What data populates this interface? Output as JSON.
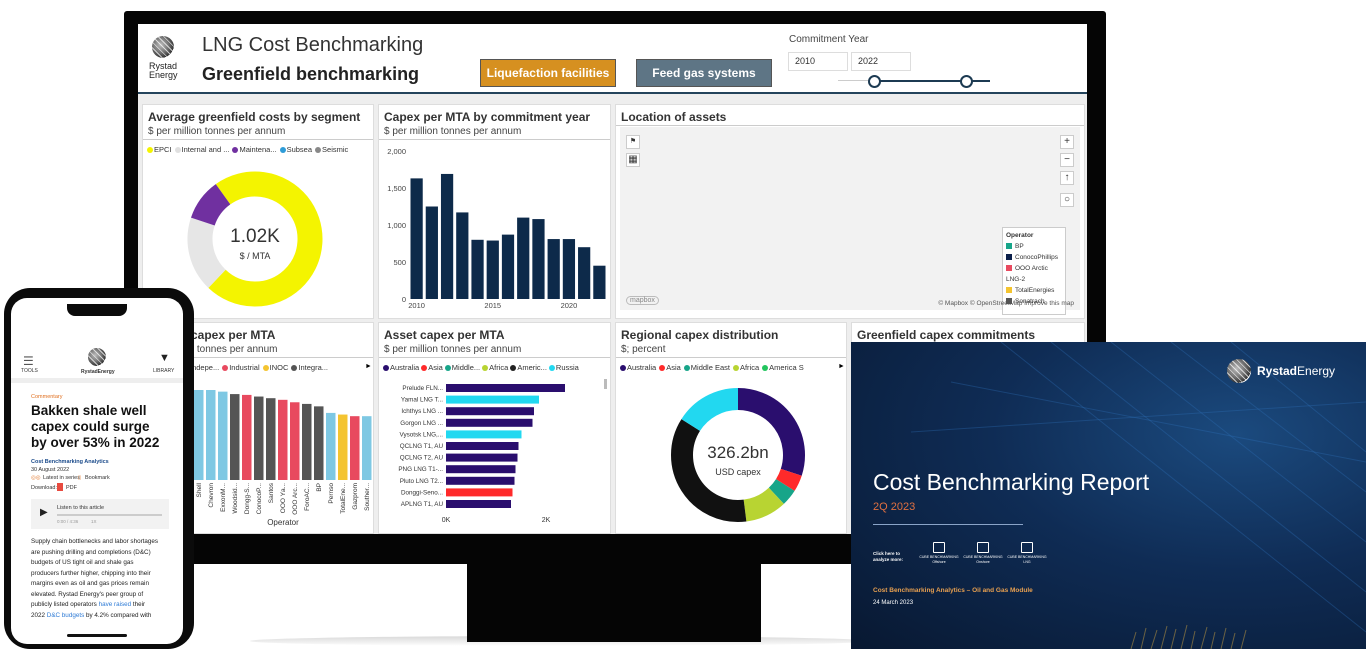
{
  "dashboard": {
    "logo_brand": "Rystad",
    "logo_sub": "Energy",
    "title": "LNG Cost Benchmarking",
    "subtitle": "Greenfield benchmarking",
    "buttons": {
      "liquefaction": "Liquefaction facilities",
      "feed_gas": "Feed gas systems"
    },
    "commitment_year": {
      "label": "Commitment Year",
      "from": "2010",
      "to": "2022"
    }
  },
  "panels": {
    "avg_costs": {
      "title": "Average greenfield costs by segment",
      "subtitle": "$ per million tonnes per annum",
      "legend": [
        {
          "label": "EPCI",
          "color": "#f4f400"
        },
        {
          "label": "Internal and ...",
          "color": "#e0e0e0"
        },
        {
          "label": "Maintena...",
          "color": "#7030a0"
        },
        {
          "label": "Subsea",
          "color": "#2e9cd8"
        },
        {
          "label": "Seismic",
          "color": "#888888"
        }
      ],
      "center_value": "1.02K",
      "center_unit": "$ / MTA"
    },
    "capex_year": {
      "title": "Capex per MTA by commitment year",
      "subtitle": "$ per million tonnes per annum"
    },
    "location": {
      "title": "Location of assets",
      "legend_title": "Operator",
      "legend_items": [
        {
          "label": "BP",
          "color": "#17a589"
        },
        {
          "label": "ConocoPhillips",
          "color": "#0b1f4a"
        },
        {
          "label": "OOO Arctic",
          "color": "#e84a5f"
        },
        {
          "label": "LNG-2",
          "color": ""
        },
        {
          "label": "TotalEnergies",
          "color": "#f4c430"
        },
        {
          "label": "Sonatrach",
          "color": "#555555"
        }
      ],
      "attribution": "© Mapbox © OpenStreetMap Improve this map",
      "mapbox_logo": "mapbox"
    },
    "operator_capex": {
      "title": "r capex per MTA",
      "subtitle": "on tonnes per annum",
      "legend": [
        {
          "label": "Indepe...",
          "color": "#7ec8e3"
        },
        {
          "label": "Industrial",
          "color": "#e84a5f"
        },
        {
          "label": "INOC",
          "color": "#f4c430"
        },
        {
          "label": "Integra...",
          "color": "#555555"
        }
      ],
      "xlabel": "Operator"
    },
    "asset_capex": {
      "title": "Asset capex per MTA",
      "subtitle": "$ per million tonnes per annum",
      "legend": [
        {
          "label": "Australia",
          "color": "#2a0e6e"
        },
        {
          "label": "Asia",
          "color": "#ff2a2a"
        },
        {
          "label": "Middle...",
          "color": "#17a589"
        },
        {
          "label": "Africa",
          "color": "#b8d432"
        },
        {
          "label": "Americ...",
          "color": "#222222"
        },
        {
          "label": "Russia",
          "color": "#22d8f0"
        }
      ]
    },
    "regional": {
      "title": "Regional capex distribution",
      "subtitle": "$; percent",
      "legend": [
        {
          "label": "Australia",
          "color": "#2a0e6e"
        },
        {
          "label": "Asia",
          "color": "#ff2a2a"
        },
        {
          "label": "Middle East",
          "color": "#17a589"
        },
        {
          "label": "Africa",
          "color": "#b8d432"
        },
        {
          "label": "America S",
          "color": "#22c55e"
        }
      ],
      "center_value": "326.2bn",
      "center_unit": "USD capex"
    },
    "commitments": {
      "title": "Greenfield capex commitments"
    }
  },
  "chart_data": [
    {
      "type": "pie",
      "title": "Average greenfield costs by segment",
      "categories": [
        "EPCI",
        "Internal and ...",
        "Maintena..."
      ],
      "values": [
        72,
        18,
        10
      ],
      "colors": [
        "#f4f400",
        "#e6e6e6",
        "#7030a0"
      ]
    },
    {
      "type": "bar",
      "title": "Capex per MTA by commitment year",
      "x": [
        2010,
        2011,
        2012,
        2013,
        2014,
        2015,
        2016,
        2017,
        2018,
        2019,
        2020,
        2021,
        2022
      ],
      "values": [
        1630,
        1250,
        1690,
        1170,
        800,
        790,
        870,
        1100,
        1080,
        810,
        810,
        700,
        450
      ],
      "ylim": [
        0,
        2000
      ],
      "yticks": [
        "0",
        "500",
        "1,000",
        "1,500",
        "2,000"
      ],
      "xticks": [
        "2010",
        "2015",
        "2020"
      ],
      "color": "#0d2a4a"
    },
    {
      "type": "bar",
      "title": "r capex per MTA",
      "categories": [
        "Shell",
        "Chevron",
        "ExxonM...",
        "Woodsid...",
        "Dongg-S...",
        "ConocoP...",
        "Santos",
        "OOO Yа...",
        "OOO Arc...",
        "ForoAC...",
        "BP",
        "Pernso",
        "TotalEne...",
        "Gazprom",
        "Souther..."
      ],
      "values": [
        1100,
        1100,
        1080,
        1050,
        1040,
        1020,
        1000,
        980,
        950,
        930,
        900,
        820,
        800,
        780,
        780
      ],
      "colors": [
        "#7ec8e3",
        "#7ec8e3",
        "#7ec8e3",
        "#555555",
        "#e84a5f",
        "#555555",
        "#555555",
        "#e84a5f",
        "#e84a5f",
        "#555555",
        "#555555",
        "#7ec8e3",
        "#f4c430",
        "#e84a5f",
        "#7ec8e3"
      ],
      "xlabel": "Operator"
    },
    {
      "type": "bar",
      "orientation": "horizontal",
      "title": "Asset capex per MTA",
      "categories": [
        "Prelude FLN...",
        "Yamal LNG T...",
        "Ichthys LNG ...",
        "Gorgon LNG ...",
        "Vysotsk LNG,...",
        "QCLNG T1, AU",
        "QCLNG T2, AU",
        "PNG LNG T1-...",
        "Pluto LNG T2...",
        "Donggi-Seno...",
        "APLNG T1, AU"
      ],
      "values": [
        2380,
        1860,
        1760,
        1730,
        1510,
        1450,
        1430,
        1390,
        1370,
        1330,
        1300
      ],
      "colors": [
        "#2a0e6e",
        "#22d8f0",
        "#2a0e6e",
        "#2a0e6e",
        "#22d8f0",
        "#2a0e6e",
        "#2a0e6e",
        "#2a0e6e",
        "#2a0e6e",
        "#ff2a2a",
        "#2a0e6e"
      ],
      "xticks": [
        "0K",
        "2K"
      ],
      "xlim": [
        0,
        2000
      ]
    },
    {
      "type": "pie",
      "title": "Regional capex distribution",
      "categories": [
        "Australia",
        "Asia",
        "Middle East",
        "Africa",
        "Americas",
        "Russia"
      ],
      "values": [
        30,
        4,
        4,
        10,
        36,
        16
      ],
      "colors": [
        "#2a0e6e",
        "#ff2a2a",
        "#17a589",
        "#b8d432",
        "#111111",
        "#22d8f0"
      ]
    }
  ],
  "phone": {
    "menu_label": "TOOLS",
    "brand": "RystadEnergy",
    "library_label": "LIBRARY",
    "category": "Commentary",
    "headline": "Bakken shale well capex could surge by over 53% in 2022",
    "author": "Cost Benchmarking Analytics",
    "date": "30 August 2022",
    "latest_in_series": "Latest in series",
    "bookmark": "Bookmark",
    "download_label": "Download:",
    "pdf_label": "PDF",
    "listen_label": "Listen to this article",
    "time": "0:00 / 4:36",
    "speed": "1X",
    "body_lines": [
      "Supply chain bottlenecks and labor shortages",
      "are pushing drilling and completions (D&C)",
      "budgets of US tight oil and shale gas",
      "producers further higher, chipping into their",
      "margins even as oil and gas prices remain",
      "elevated. Rystad Energy's peer group of",
      "publicly listed operators",
      "2022",
      "by 4.2% compared with"
    ],
    "link1": "have raised",
    "link1_after": "their",
    "link2": "D&C budgets"
  },
  "report": {
    "brand_strong": "Rystad",
    "brand_rest": "Energy",
    "title": "Cost Benchmarking Report",
    "quarter": "2Q 2023",
    "click_here": "Click here to analyze more:",
    "modules": [
      "CUBE BENCHMARKING Offshore",
      "CUBE BENCHMARKING Onshore",
      "CUBE BENCHMARKING LNG"
    ],
    "footer_title": "Cost Benchmarking Analytics – Oil and Gas Module",
    "footer_date": "24 March 2023"
  }
}
